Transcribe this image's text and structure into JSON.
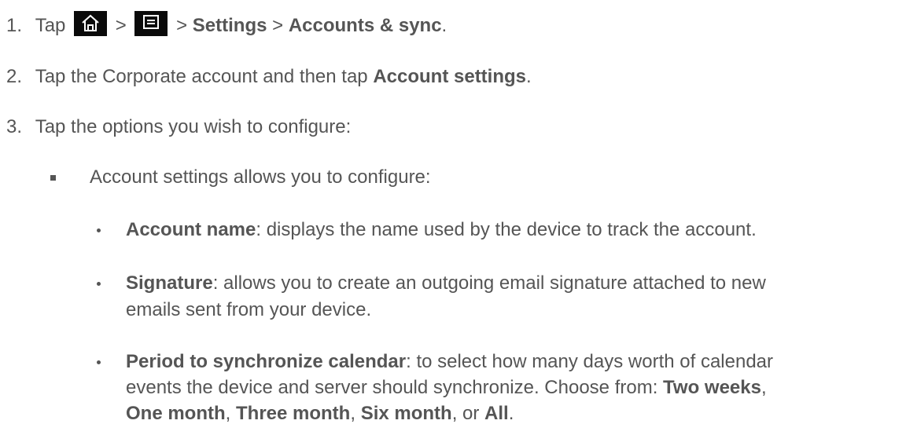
{
  "steps": [
    {
      "number": "1.",
      "parts": {
        "tap": "Tap",
        "sep1": ">",
        "sep2": ">",
        "settings": "Settings",
        "sep3": ">",
        "accounts": "Accounts & sync",
        "end": "."
      },
      "icons": [
        "home-icon",
        "menu-icon"
      ]
    },
    {
      "number": "2.",
      "parts": {
        "text": "Tap the Corporate account and then tap ",
        "bold": "Account settings",
        "end": "."
      }
    },
    {
      "number": "3.",
      "text": "Tap the options you wish to configure:"
    }
  ],
  "sub_item": {
    "text": "Account settings allows you to configure:"
  },
  "options": [
    {
      "term": "Account name",
      "desc": ": displays the name used by the device to track the account."
    },
    {
      "term": "Signature",
      "desc_line1": ": allows you to create an outgoing email signature attached to new",
      "desc_line2": "emails sent from your device."
    },
    {
      "term": "Period to synchronize calendar",
      "desc_line1": ": to select how many days worth of calendar",
      "desc_line2a": "events the device and server should synchronize. Choose from: ",
      "choice1": "Two weeks",
      "comma1": ",",
      "choice2": "One month",
      "comma2": ", ",
      "choice3": "Three month",
      "comma3": ", ",
      "choice4": "Six month",
      "or": ", or ",
      "choice5": "All",
      "end": "."
    }
  ]
}
